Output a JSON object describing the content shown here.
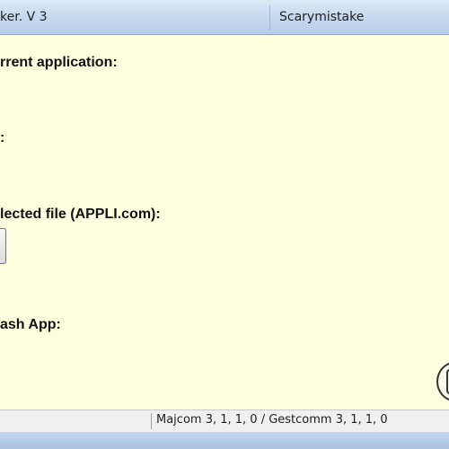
{
  "window": {
    "title_left": "ker. V 3",
    "title_right": "Scarymistake"
  },
  "main": {
    "label_current_application": "rrent application:",
    "label_colon": ":",
    "label_selected_file": "lected file (APPLI.com):",
    "label_flash_app": "ash App:"
  },
  "statusbar": {
    "versions": "Majcom 3, 1, 1, 0 / Gestcomm 3, 1, 1, 0"
  },
  "icons": {
    "logo": "app-logo-icon"
  },
  "colors": {
    "client_background": "#ffffe0",
    "titlebar": "#c7daf0",
    "statusbar": "#f0f0f0"
  }
}
